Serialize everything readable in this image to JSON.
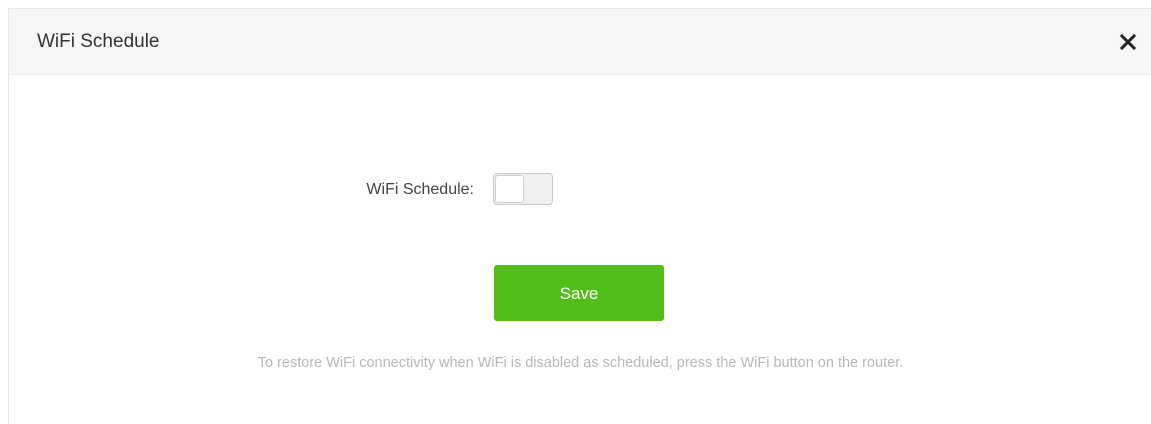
{
  "dialog": {
    "title": "WiFi Schedule",
    "close_icon": "close-icon"
  },
  "form": {
    "wifi_schedule_label": "WiFi Schedule:",
    "wifi_schedule_enabled": false
  },
  "actions": {
    "save_label": "Save"
  },
  "note": "To restore WiFi connectivity when WiFi is disabled as scheduled, press the WiFi button on the router.",
  "colors": {
    "save_button": "#53bd1a",
    "header_bg": "#f7f7f7",
    "note_text": "#b8b8b8"
  }
}
